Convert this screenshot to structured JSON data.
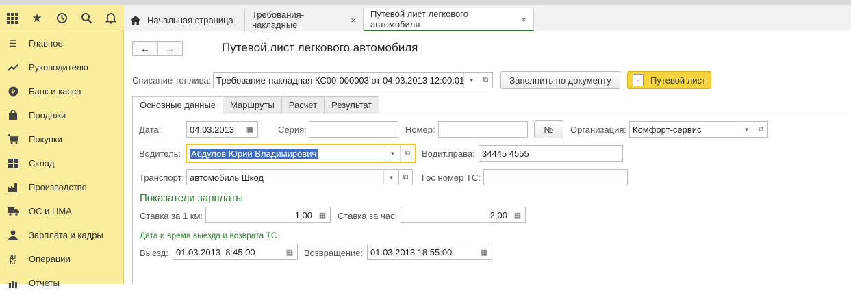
{
  "toolbar": {
    "icons": [
      "apps-grid-icon",
      "star-icon",
      "history-icon",
      "search-icon",
      "bell-icon"
    ]
  },
  "sidebar": {
    "items": [
      {
        "label": "Главное",
        "icon": "menu-lines-icon"
      },
      {
        "label": "Руководителю",
        "icon": "trend-up-icon"
      },
      {
        "label": "Банк и касса",
        "icon": "ruble-coin-icon"
      },
      {
        "label": "Продажи",
        "icon": "shopping-bag-icon"
      },
      {
        "label": "Покупки",
        "icon": "cart-icon"
      },
      {
        "label": "Склад",
        "icon": "warehouse-grid-icon"
      },
      {
        "label": "Производство",
        "icon": "factory-icon"
      },
      {
        "label": "ОС и НМА",
        "icon": "truck-icon"
      },
      {
        "label": "Зарплата и кадры",
        "icon": "person-icon"
      },
      {
        "label": "Операции",
        "icon": "debit-credit-icon"
      },
      {
        "label": "Отчеты",
        "icon": "report-icon"
      }
    ]
  },
  "tabs": [
    {
      "label": "Начальная страница",
      "icon": "home-icon"
    },
    {
      "label": "Требования-накладные",
      "close": "×"
    },
    {
      "label": "Путевой лист легкового автомобиля",
      "close": "×"
    }
  ],
  "page": {
    "title": "Путевой лист легкового автомобиля",
    "back": "←",
    "forward": "→"
  },
  "fuel": {
    "label": "Списание топлива:",
    "value": "Требование-накладная КС00-000003 от 04.03.2013 12:00:01",
    "fill_button": "Заполнить по документу",
    "waybill_button": "Путевой лист"
  },
  "form_tabs": [
    "Основные данные",
    "Маршруты",
    "Расчет",
    "Результат"
  ],
  "main": {
    "date_label": "Дата:",
    "date_value": "04.03.2013",
    "series_label": "Серия:",
    "series_value": "",
    "number_label": "Номер:",
    "number_value": "",
    "number_button": "№",
    "org_label": "Организация:",
    "org_value": "Комфорт-сервис",
    "driver_label": "Водитель:",
    "driver_value": "Абдулов Юрий Владимирович",
    "license_label": "Водит.права:",
    "license_value": "34445  4555",
    "transport_label": "Транспорт:",
    "transport_value": "автомобиль Шкод",
    "plate_label": "Гос номер ТС:",
    "plate_value": ""
  },
  "salary": {
    "heading": "Показатели зарплаты",
    "per_km_label": "Ставка за 1 км:",
    "per_km_value": "1,00",
    "per_hour_label": "Ставка за час:",
    "per_hour_value": "2,00"
  },
  "trip": {
    "heading": "Дата и время выезда и возврата ТС",
    "depart_label": "Выезд:",
    "depart_value": "01.03.2013  8:45:00",
    "return_label": "Возвращение:",
    "return_value": "01.03.2013 18:55:00"
  },
  "colors": {
    "sidebar": "#fbed9e",
    "accent_green": "#2e7d32",
    "focus": "#f0c51a",
    "yellow_button": "#f7d33c"
  }
}
